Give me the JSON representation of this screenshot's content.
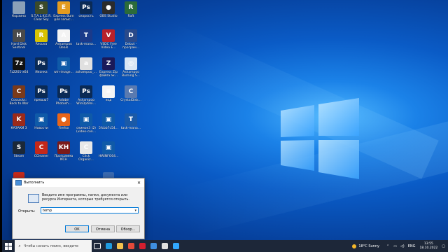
{
  "desktop": {
    "icons": [
      {
        "label": "Корзина",
        "color": "#8aa0b8",
        "glyph": ""
      },
      {
        "label": "S.T.A.L.K.E.R.\nClear Sky",
        "color": "#3b4a2a",
        "glyph": "S"
      },
      {
        "label": "Express Burn\nдля запис...",
        "color": "#e39b1f",
        "glyph": "E"
      },
      {
        "label": "скорость",
        "color": "#0a2a55",
        "glyph": "Ps"
      },
      {
        "label": "OBS Studio",
        "color": "#2b2b2b",
        "glyph": "●"
      },
      {
        "label": "Raft",
        "color": "#2b6b3a",
        "glyph": "R"
      },
      {
        "label": "Hard Disk\nSentinel",
        "color": "#4a4a4a",
        "glyph": "H"
      },
      {
        "label": "Recuva",
        "color": "#d8c200",
        "glyph": "R"
      },
      {
        "label": "Ashampoo\nDeals",
        "color": "#f3f3f3",
        "glyph": "A"
      },
      {
        "label": "task-mana...",
        "color": "#1a3a8a",
        "glyph": "T"
      },
      {
        "label": "VSDC Free\nVideo E...",
        "color": "#b8212b",
        "glyph": "V"
      },
      {
        "label": "Debut -\nпрограм...",
        "color": "#2a4a8a",
        "glyph": "D"
      },
      {
        "label": "7z2201-x64",
        "color": "#111111",
        "glyph": "7z"
      },
      {
        "label": "Иконка",
        "color": "#0a2a55",
        "glyph": "Ps"
      },
      {
        "label": "win-image...",
        "color": "#0f5aa8",
        "glyph": "▣"
      },
      {
        "label": "ashampoo_...",
        "color": "#e0e0e0",
        "glyph": "a"
      },
      {
        "label": "Express Zip\nфайла эк...",
        "color": "#1a1a5a",
        "glyph": "Z"
      },
      {
        "label": "Ashampoo\nBurning S...",
        "color": "#d8e6f5",
        "glyph": "◎"
      },
      {
        "label": "Cossacks:\nBack to War",
        "color": "#7a3a1a",
        "glyph": "C"
      },
      {
        "label": "превью7",
        "color": "#0a2a55",
        "glyph": "Ps"
      },
      {
        "label": "Adobe\nPhotosh...",
        "color": "#0a2a55",
        "glyph": "Ps"
      },
      {
        "label": "Ashampoo\nWinOptimi...",
        "color": "#0a2a55",
        "glyph": "Ps"
      },
      {
        "label": "код",
        "color": "#f5f5f5",
        "glyph": "≡"
      },
      {
        "label": "CrystalDisk...",
        "color": "#5a7ab0",
        "glyph": "C"
      },
      {
        "label": "КАЗАКИ 3",
        "color": "#9a2a1a",
        "glyph": "K"
      },
      {
        "label": "Новости",
        "color": "#0f5aa8",
        "glyph": "▣"
      },
      {
        "label": "Firefox",
        "color": "#e8651a",
        "glyph": "●"
      },
      {
        "label": "снимок3 (2)\n(video-con...",
        "color": "#0f5aa8",
        "glyph": "▣"
      },
      {
        "label": "5fcbb7c54...",
        "color": "#0f5aa8",
        "glyph": "▣"
      },
      {
        "label": "task-mana...",
        "color": "#1a5aa8",
        "glyph": "T"
      },
      {
        "label": "Steam",
        "color": "#1b2838",
        "glyph": "S"
      },
      {
        "label": "CCleaner",
        "color": "#c4281a",
        "glyph": "C"
      },
      {
        "label": "Программа\nNCH",
        "color": "#7a1a1a",
        "glyph": "KH"
      },
      {
        "label": "Click\nOrganiz...",
        "color": "#e8e8e8",
        "glyph": "C"
      },
      {
        "label": "HWiNFO64...",
        "color": "#0f5aa8",
        "glyph": "▣"
      }
    ]
  },
  "run_dialog": {
    "title": "Выполнить",
    "description": "Введите имя программы, папки, документа или ресурса Интернета, которые требуется открыть.",
    "open_label": "Открыть:",
    "input_value": "temp",
    "ok_label": "ОК",
    "cancel_label": "Отмена",
    "browse_label": "Обзор...",
    "close_glyph": "✕"
  },
  "taskbar": {
    "search_placeholder": "Чтобы начать поиск, введите",
    "apps": [
      {
        "name": "task-view",
        "color": "#ffffff"
      },
      {
        "name": "edge",
        "color": "#1f9be0"
      },
      {
        "name": "explorer",
        "color": "#f2c14e"
      },
      {
        "name": "chrome",
        "color": "#e54a3a"
      },
      {
        "name": "opera",
        "color": "#d41f2f"
      },
      {
        "name": "mail",
        "color": "#3f8fe0"
      },
      {
        "name": "obs",
        "color": "#e0e0e0"
      },
      {
        "name": "photoshop",
        "color": "#31a8ff"
      }
    ],
    "weather": "18°C  Sunny",
    "language": "ENG",
    "time": "13:55",
    "date": "18.10.2022",
    "colors": {
      "background": "#1d2739",
      "search": "#f3f3f3"
    }
  }
}
